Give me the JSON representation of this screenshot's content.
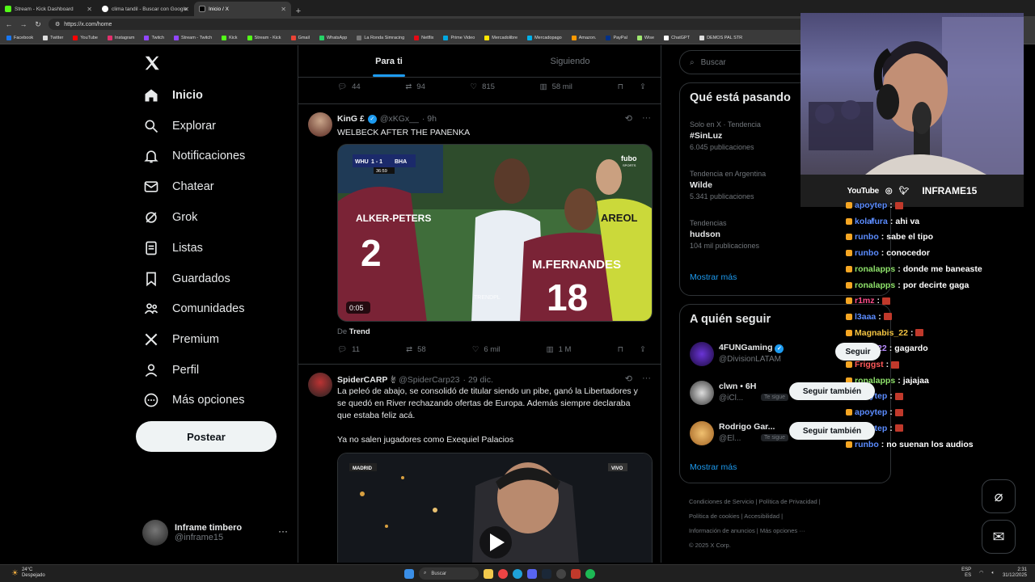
{
  "browser": {
    "tabs": [
      {
        "label": "Stream - Kick Dashboard",
        "color": "#53fc18"
      },
      {
        "label": "clima tandil - Buscar con Google",
        "color": "#ffffff"
      },
      {
        "label": "Inicio / X",
        "color": "#000000"
      }
    ],
    "url": "https://x.com/home",
    "bookmarks": [
      {
        "label": "Facebook",
        "color": "#1877f2"
      },
      {
        "label": "Twitter",
        "color": "#dddddd"
      },
      {
        "label": "YouTube",
        "color": "#ff0000"
      },
      {
        "label": "Instagram",
        "color": "#e1306c"
      },
      {
        "label": "Twitch",
        "color": "#9146ff"
      },
      {
        "label": "Stream - Twitch",
        "color": "#9146ff"
      },
      {
        "label": "Kick",
        "color": "#53fc18"
      },
      {
        "label": "Stream - Kick",
        "color": "#53fc18"
      },
      {
        "label": "Gmail",
        "color": "#ea4335"
      },
      {
        "label": "WhatsApp",
        "color": "#25d366"
      },
      {
        "label": "La Ronda Simracing",
        "color": "#777777"
      },
      {
        "label": "Netflix",
        "color": "#e50914"
      },
      {
        "label": "Prime Video",
        "color": "#00a8e1"
      },
      {
        "label": "Mercadolibre",
        "color": "#ffe600"
      },
      {
        "label": "Mercadopago",
        "color": "#00b1ea"
      },
      {
        "label": "Amazon.",
        "color": "#ff9900"
      },
      {
        "label": "PayPal",
        "color": "#003087"
      },
      {
        "label": "Wise",
        "color": "#9fe870"
      },
      {
        "label": "ChatGPT",
        "color": "#ffffff"
      },
      {
        "label": "DEMOS PAL STR",
        "color": "#dddddd"
      }
    ]
  },
  "nav": {
    "items": [
      {
        "label": "Inicio",
        "icon": "home-icon"
      },
      {
        "label": "Explorar",
        "icon": "search-icon"
      },
      {
        "label": "Notificaciones",
        "icon": "bell-icon"
      },
      {
        "label": "Chatear",
        "icon": "mail-icon"
      },
      {
        "label": "Grok",
        "icon": "grok-icon"
      },
      {
        "label": "Listas",
        "icon": "list-icon"
      },
      {
        "label": "Guardados",
        "icon": "bookmark-icon"
      },
      {
        "label": "Comunidades",
        "icon": "communities-icon"
      },
      {
        "label": "Premium",
        "icon": "x-icon"
      },
      {
        "label": "Perfil",
        "icon": "person-icon"
      },
      {
        "label": "Más opciones",
        "icon": "more-circle-icon"
      }
    ],
    "post_label": "Postear",
    "account": {
      "name": "Inframe timbero",
      "handle": "@inframe15"
    }
  },
  "feed": {
    "tabs": [
      "Para ti",
      "Siguiendo"
    ],
    "prev_actions": {
      "replies": "44",
      "reposts": "94",
      "likes": "815",
      "views": "58 mil"
    },
    "tweet1": {
      "name": "KinG £",
      "handle": "@xKGx__",
      "time": "· 9h",
      "text": "WELBECK AFTER THE PANENKA",
      "video_time": "0:05",
      "score_home": "WHU",
      "score": "1 - 1",
      "score_away": "BHA",
      "match_clock": "36:59",
      "broadcaster": "fubo",
      "broadcaster_sub": "SPORTS",
      "watermark": "TRENDPL",
      "jersey1": "2",
      "jersey2": "18",
      "jersey2_name": "M.FERNANDES",
      "jersey3_name": "AREOL",
      "from_prefix": "De",
      "from_name": "Trend",
      "actions": {
        "replies": "11",
        "reposts": "58",
        "likes": "6 mil",
        "views": "1 M"
      }
    },
    "tweet2": {
      "name": "SpiderCARP",
      "handle": "@SpiderCarp23",
      "time": "· 29 dic.",
      "text": "La peleó de abajo, se consolidó de titular siendo un pibe, ganó la Libertadores y se quedó en River rechazando ofertas de Europa. Además siempre declaraba que estaba feliz acá.\n\nYa no salen jugadores como Exequiel Palacios",
      "video_tag_left": "MADRID",
      "video_tag_right": "VIVO"
    }
  },
  "right": {
    "search_placeholder": "Buscar",
    "trends_title": "Qué está pasando",
    "trends": [
      {
        "context": "Solo en X · Tendencia",
        "title": "#SinLuz",
        "count": "6.045 publicaciones"
      },
      {
        "context": "Tendencia en Argentina",
        "title": "Wilde",
        "count": "5.341 publicaciones"
      },
      {
        "context": "Tendencias",
        "title": "hudson",
        "count": "104 mil publicaciones"
      }
    ],
    "trends_more": "Mostrar más",
    "follow_title": "A quién seguir",
    "follow": [
      {
        "name": "4FUNGaming",
        "handle": "@DivisionLATAM",
        "badge": "",
        "button": "Seguir"
      },
      {
        "name": "clwn • 6H",
        "handle": "@iCl...",
        "badge": "Te sigue",
        "button": "Seguir también"
      },
      {
        "name": "Rodrigo Gar...",
        "handle": "@El...",
        "badge": "Te sigue",
        "button": "Seguir también"
      }
    ],
    "follow_more": "Mostrar más",
    "footer": [
      "Condiciones de Servicio",
      "Política de Privacidad",
      "Política de cookies",
      "Accesibilidad",
      "Información de anuncios",
      "Más opciones ···",
      "© 2025 X Corp."
    ]
  },
  "overlay": {
    "social_youtube": "YouTube",
    "channel": "INFRAME15",
    "chat": [
      {
        "user": "apoytep",
        "msg": "",
        "color": "#5b8cff"
      },
      {
        "user": "kola̸fura",
        "msg": "ahi va",
        "color": "#5b8cff"
      },
      {
        "user": "runbo",
        "msg": "sabe el tipo",
        "color": "#5b8cff"
      },
      {
        "user": "runbo",
        "msg": "conocedor",
        "color": "#5b8cff"
      },
      {
        "user": "ronalapps",
        "msg": "donde me baneaste",
        "color": "#8fe36b"
      },
      {
        "user": "ronalapps",
        "msg": "por decirte gaga",
        "color": "#8fe36b"
      },
      {
        "user": "r1mz",
        "msg": "",
        "color": "#ff4f8b"
      },
      {
        "user": "l3aaa",
        "msg": "",
        "color": "#5b8cff"
      },
      {
        "user": "Magnabis_22",
        "msg": "",
        "color": "#f5c542"
      },
      {
        "user": "Lubi922",
        "msg": "gagardo",
        "color": "#b98cff"
      },
      {
        "user": "Friggst",
        "msg": "",
        "color": "#ff5a5a"
      },
      {
        "user": "ronalapps",
        "msg": "jajajaa",
        "color": "#8fe36b"
      },
      {
        "user": "apoytep",
        "msg": "",
        "color": "#5b8cff"
      },
      {
        "user": "apoytep",
        "msg": "",
        "color": "#5b8cff"
      },
      {
        "user": "apoytep",
        "msg": "",
        "color": "#5b8cff"
      },
      {
        "user": "runbo",
        "msg": "no suenan los audios",
        "color": "#5b8cff"
      }
    ]
  },
  "taskbar": {
    "temp": "24°C",
    "weather": "Despejado",
    "search": "Buscar",
    "lang1": "ESP",
    "lang2": "ES",
    "time": "2:31",
    "date": "31/12/2025"
  },
  "colors": {
    "accent": "#1d9bf0",
    "bg": "#000000",
    "text": "#e7e9ea",
    "muted": "#71767b"
  }
}
